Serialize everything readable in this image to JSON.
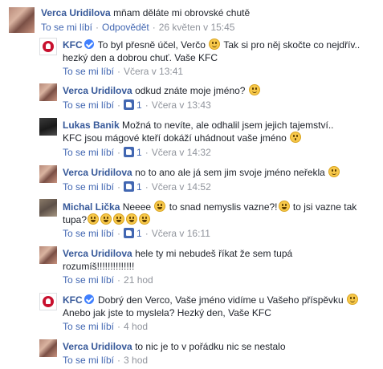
{
  "like_label": "To se mi líbí",
  "reply_label": "Odpovědět",
  "c1": {
    "author": "Verca Uridilova",
    "text": "mňam děláte mi obrovské chutě",
    "time": "26 květen v 15:45"
  },
  "c2": {
    "author": "KFC",
    "line1": "To byl přesně účel, Verčo",
    "line1b": "Tak si pro něj skočte co nejdřív..",
    "line2": "hezký den a dobrou chuť. Vaše KFC",
    "time": "Včera v 13:41"
  },
  "c3": {
    "author": "Verca Uridilova",
    "text": "odkud znáte moje jméno?",
    "likes": "1",
    "time": "Včera v 13:43"
  },
  "c4": {
    "author": "Lukas Banik",
    "line1": "Možná to nevíte, ale odhalil jsem jejich tajemství..",
    "line2": "KFC jsou mágové kteří dokáží uhádnout vaše jméno",
    "likes": "1",
    "time": "Včera v 14:32"
  },
  "c5": {
    "author": "Verca Uridilova",
    "text": "no to ano ale já sem jim svoje jméno neřekla",
    "likes": "1",
    "time": "Včera v 14:52"
  },
  "c6": {
    "author": "Michal Lička",
    "line1a": "Neeee",
    "line1b": "to snad nemyslis vazne?!",
    "line1c": "to jsi vazne tak",
    "line2": "tupa?",
    "likes": "1",
    "time": "Včera v 16:11"
  },
  "c7": {
    "author": "Verca Uridilova",
    "line1": "hele ty mi nebudeš říkat že sem tupá",
    "line2": "rozumíš!!!!!!!!!!!!!!",
    "time": "21 hod"
  },
  "c8": {
    "author": "KFC",
    "line1": "Dobrý den Verco, Vaše jméno vidíme u Vašeho příspěvku",
    "line2": "Anebo jak jste to myslela? Hezký den, Vaše KFC",
    "time": "4 hod"
  },
  "c9": {
    "author": "Verca Uridilova",
    "text": "to nic je to v pořádku nic se nestalo",
    "time": "3 hod"
  },
  "icons": {
    "verified": "verified-badge-icon",
    "like": "like-thumb-icon",
    "emoji": "smiley-emoji-icon"
  }
}
